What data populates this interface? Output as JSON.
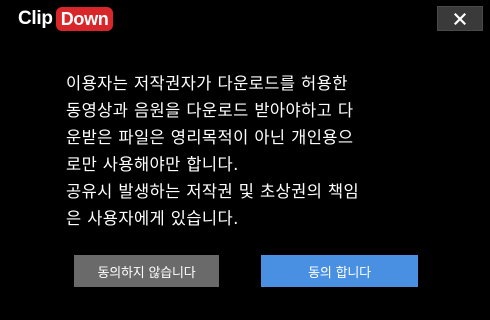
{
  "app": {
    "brand_part1": "Clip",
    "brand_part2": "Down"
  },
  "titlebar": {
    "close_icon": "close-icon",
    "close_glyph": "×"
  },
  "dialog": {
    "message_lines": [
      "이용자는 저작권자가 다운로드를 허용한",
      "동영상과 음원을 다운로드 받아야하고 다",
      "운받은 파일은 영리목적이 아닌 개인용으",
      "로만 사용해야만 합니다.",
      "공유시 발생하는 저작권 및 초상권의 책임",
      "은 사용자에게 있습니다."
    ]
  },
  "buttons": {
    "decline_label": "동의하지 않습니다",
    "accept_label": "동의 합니다"
  },
  "colors": {
    "background": "#000000",
    "brand_red": "#d8262b",
    "decline_gray": "#6a6a6a",
    "accept_blue": "#4a90e2",
    "text": "#ffffff"
  }
}
